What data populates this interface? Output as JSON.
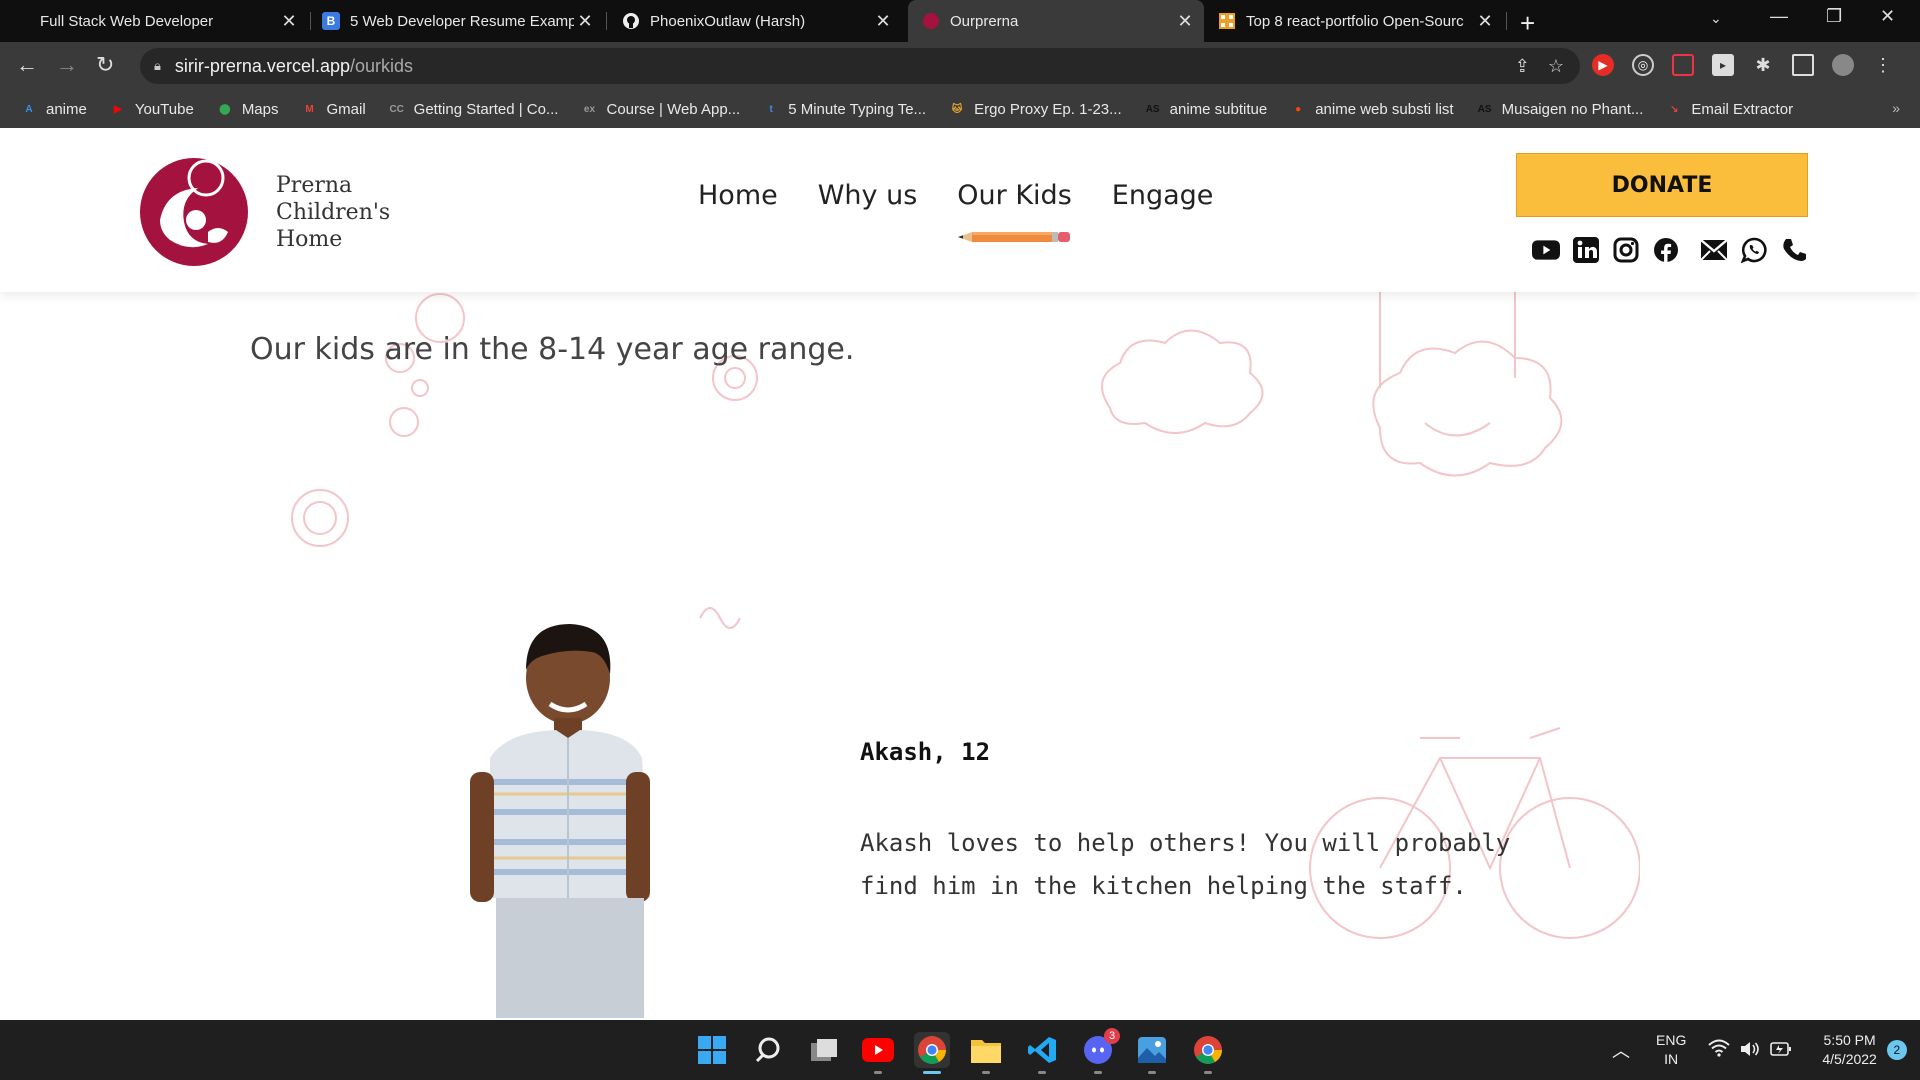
{
  "browser": {
    "tabs": [
      {
        "title": "Full Stack Web Developer",
        "icon": "blank-icon",
        "active": false
      },
      {
        "title": "5 Web Developer Resume Examp",
        "icon": "b-icon",
        "active": false
      },
      {
        "title": "PhoenixOutlaw (Harsh)",
        "icon": "github-icon",
        "active": false
      },
      {
        "title": "Ourprerna",
        "icon": "prerna-favicon",
        "active": true
      },
      {
        "title": "Top 8 react-portfolio Open-Sourc",
        "icon": "grid-icon",
        "active": false
      }
    ],
    "url_host": "sirir-prerna.vercel.app",
    "url_path": "/ourkids",
    "bookmarks": [
      {
        "label": "anime",
        "icon": "a-icon",
        "color": "#3a8ee6"
      },
      {
        "label": "YouTube",
        "icon": "youtube-icon",
        "color": "#ff0000"
      },
      {
        "label": "Maps",
        "icon": "maps-icon",
        "color": "#34a853"
      },
      {
        "label": "Gmail",
        "icon": "gmail-icon",
        "color": "#ea4335"
      },
      {
        "label": "Getting Started | Co...",
        "icon": "cc-icon",
        "color": "#999999"
      },
      {
        "label": "Course | Web App...",
        "icon": "edx-icon",
        "color": "#999999"
      },
      {
        "label": "5 Minute Typing Te...",
        "icon": "t-icon",
        "color": "#3a8ee6"
      },
      {
        "label": "Ergo Proxy Ep. 1-23...",
        "icon": "cat-icon",
        "color": "#e5a72b"
      },
      {
        "label": "anime subtitue",
        "icon": "as-icon",
        "color": "#111111"
      },
      {
        "label": "anime web substi list",
        "icon": "reddit-icon",
        "color": "#ff4500"
      },
      {
        "label": "Musaigen no Phant...",
        "icon": "as-icon",
        "color": "#111111"
      },
      {
        "label": "Email Extractor",
        "icon": "arrow-icon",
        "color": "#e04040"
      }
    ],
    "bookmarks_more": "»"
  },
  "site": {
    "brand_lines": [
      "Prerna",
      "Children's",
      "Home"
    ],
    "nav": [
      "Home",
      "Why us",
      "Our Kids",
      "Engage"
    ],
    "active_nav": "Our Kids",
    "donate_label": "DONATE",
    "socials": [
      "youtube-icon",
      "linkedin-icon",
      "instagram-icon",
      "facebook-icon",
      "email-icon",
      "whatsapp-icon",
      "phone-icon"
    ],
    "intro": "Our kids are in the 8-14 year age range.",
    "kid": {
      "name": "Akash, 12",
      "description": "Akash loves to help others! You will probably find him in the kitchen helping the staff."
    },
    "colors": {
      "brand": "#a4123f",
      "donate": "#fbbd3c",
      "doodle": "#f3c4c8"
    }
  },
  "taskbar": {
    "apps": [
      "windows-start-icon",
      "search-icon",
      "task-view-icon",
      "youtube-icon",
      "chrome-icon",
      "file-explorer-icon",
      "vscode-icon",
      "discord-icon",
      "photos-icon",
      "chrome-icon"
    ],
    "discord_badge": "3",
    "lang_line1": "ENG",
    "lang_line2": "IN",
    "time": "5:50 PM",
    "date": "4/5/2022",
    "notification_count": "2"
  }
}
